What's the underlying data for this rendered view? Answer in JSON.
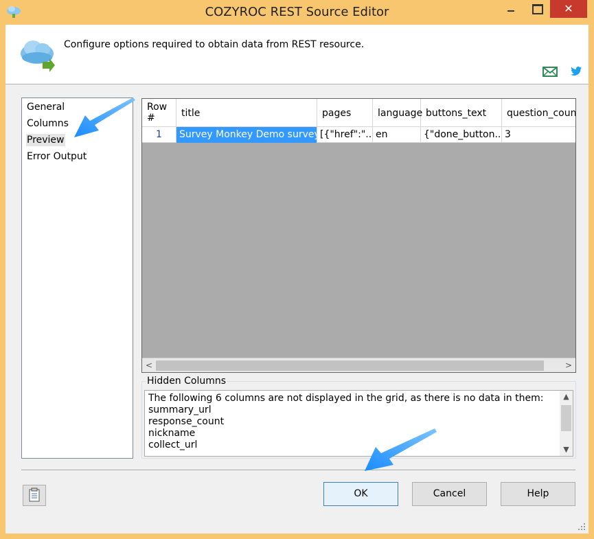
{
  "window": {
    "title": "COZYROC REST Source Editor",
    "close_glyph": "✕"
  },
  "header": {
    "description": "Configure options required to obtain data from REST resource."
  },
  "nav": {
    "items": [
      {
        "label": "General"
      },
      {
        "label": "Columns"
      },
      {
        "label": "Preview"
      },
      {
        "label": "Error Output"
      }
    ],
    "selected": "Preview"
  },
  "grid": {
    "columns": [
      "Row #",
      "title",
      "pages",
      "language",
      "buttons_text",
      "question_count"
    ],
    "rows": [
      [
        "1",
        "Survey Monkey Demo survey",
        "[{\"href\":\"...",
        "en",
        "{\"done_button...",
        "3"
      ]
    ],
    "scroll_left_glyph": "<",
    "scroll_right_glyph": ">"
  },
  "hidden_columns": {
    "label": "Hidden Columns",
    "message": "The following 6 columns are not displayed in the grid, as there is no data in them:",
    "items": [
      "summary_url",
      "response_count",
      "nickname",
      "collect_url"
    ]
  },
  "buttons": {
    "ok": "OK",
    "cancel": "Cancel",
    "help": "Help"
  },
  "colors": {
    "titlebar": "#f7c66f",
    "close": "#c7392c",
    "selection": "#3399ff",
    "annotation_arrow": "#1a8cff"
  },
  "icons": {
    "app": "cloud-icon",
    "header": "cloud-arrow-icon",
    "mail": "mail-icon",
    "twitter": "twitter-icon",
    "copy": "clipboard-icon"
  }
}
